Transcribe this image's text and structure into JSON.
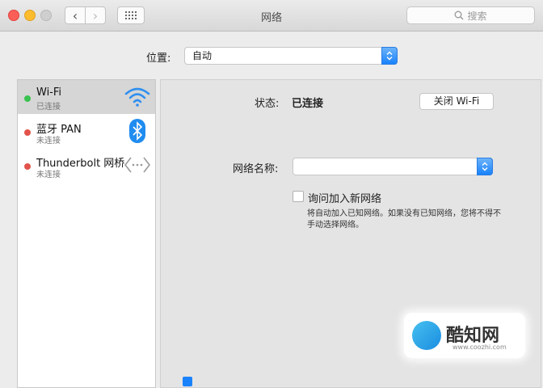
{
  "window": {
    "title": "网络"
  },
  "search": {
    "placeholder": "搜索"
  },
  "location": {
    "label": "位置:",
    "value": "自动"
  },
  "services": [
    {
      "name": "Wi-Fi",
      "status": "已连接",
      "status_color": "#39c350",
      "icon": "wifi-icon",
      "selected": true
    },
    {
      "name": "蓝牙 PAN",
      "status": "未连接",
      "status_color": "#e2534b",
      "icon": "bluetooth-icon",
      "selected": false
    },
    {
      "name": "Thunderbolt 网桥",
      "status": "未连接",
      "status_color": "#e2534b",
      "icon": "thunderbolt-bridge-icon",
      "selected": false
    }
  ],
  "detail": {
    "status_label": "状态:",
    "status_value": "已连接",
    "turn_off_button": "关闭 Wi-Fi",
    "network_name_label": "网络名称:",
    "network_name_value": "",
    "ask_join_label": "询问加入新网络",
    "ask_join_checked": false,
    "ask_join_help": "将自动加入已知网络。如果没有已知网络，您将不得不手动选择网络。"
  },
  "watermark": {
    "text": "酷知网",
    "sub": "www.coozhi.com"
  }
}
